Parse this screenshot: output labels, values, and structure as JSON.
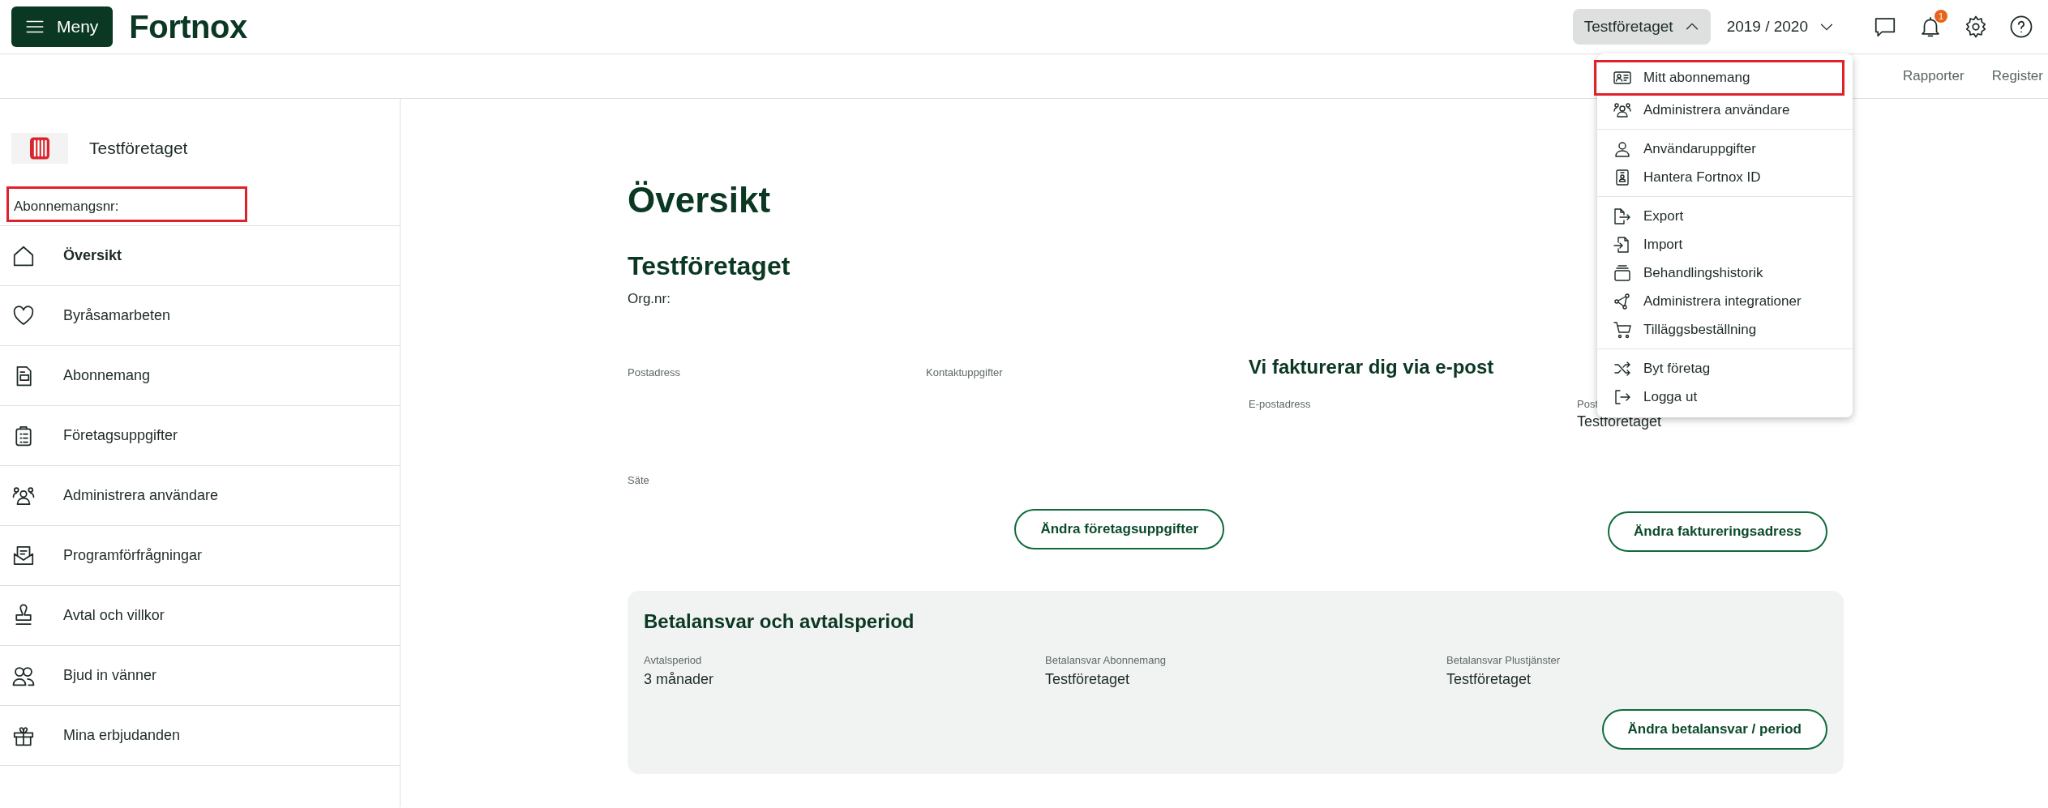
{
  "topbar": {
    "menu_button": {
      "label": "Meny"
    },
    "logo": "Fortnox",
    "company_button": {
      "label": "Testföretaget",
      "expanded": true
    },
    "year_selector": {
      "label": "2019 / 2020"
    },
    "notification_badge": "1"
  },
  "subnav": {
    "links": [
      "Rapporter",
      "Register"
    ]
  },
  "sidebar": {
    "company_name": "Testföretaget",
    "subscription_label": {
      "text": "Abonnemangsnr:",
      "highlighted": true
    },
    "items": [
      {
        "label": "Översikt",
        "selected": true
      },
      {
        "label": "Byråsamarbeten",
        "selected": false
      },
      {
        "label": "Abonnemang",
        "selected": false
      },
      {
        "label": "Företagsuppgifter",
        "selected": false
      },
      {
        "label": "Administrera användare",
        "selected": false
      },
      {
        "label": "Programförfrågningar",
        "selected": false
      },
      {
        "label": "Avtal och villkor",
        "selected": false
      },
      {
        "label": "Bjud in vänner",
        "selected": false
      },
      {
        "label": "Mina erbjudanden",
        "selected": false
      }
    ]
  },
  "main": {
    "title": "Översikt",
    "company_heading": "Testföretaget",
    "org_label": "Org.nr:",
    "company_fields": [
      "Postadress",
      "Kontaktuppgifter",
      "Säte"
    ],
    "company_button": "Ändra företagsuppgifter",
    "billing": {
      "heading": "Vi fakturerar dig via e-post",
      "email_label": "E-postadress",
      "post_label": "Post",
      "post_value": "Testföretaget",
      "button": "Ändra faktureringsadress"
    },
    "card": {
      "title": "Betalansvar och avtalsperiod",
      "fields": [
        {
          "label": "Avtalsperiod",
          "value": "3 månader"
        },
        {
          "label": "Betalansvar Abonnemang",
          "value": "Testföretaget"
        },
        {
          "label": "Betalansvar Plustjänster",
          "value": "Testföretaget"
        }
      ],
      "button": "Ändra betalansvar / period"
    }
  },
  "dropdown": {
    "groups": [
      [
        {
          "label": "Mitt abonnemang",
          "highlighted": true
        },
        {
          "label": "Administrera användare",
          "highlighted": false
        }
      ],
      [
        {
          "label": "Användaruppgifter",
          "highlighted": false
        },
        {
          "label": "Hantera Fortnox ID",
          "highlighted": false
        }
      ],
      [
        {
          "label": "Export",
          "highlighted": false
        },
        {
          "label": "Import",
          "highlighted": false
        },
        {
          "label": "Behandlingshistorik",
          "highlighted": false
        },
        {
          "label": "Administrera integrationer",
          "highlighted": false
        },
        {
          "label": "Tilläggsbeställning",
          "highlighted": false
        }
      ],
      [
        {
          "label": "Byt företag",
          "highlighted": false
        },
        {
          "label": "Logga ut",
          "highlighted": false
        }
      ]
    ]
  }
}
